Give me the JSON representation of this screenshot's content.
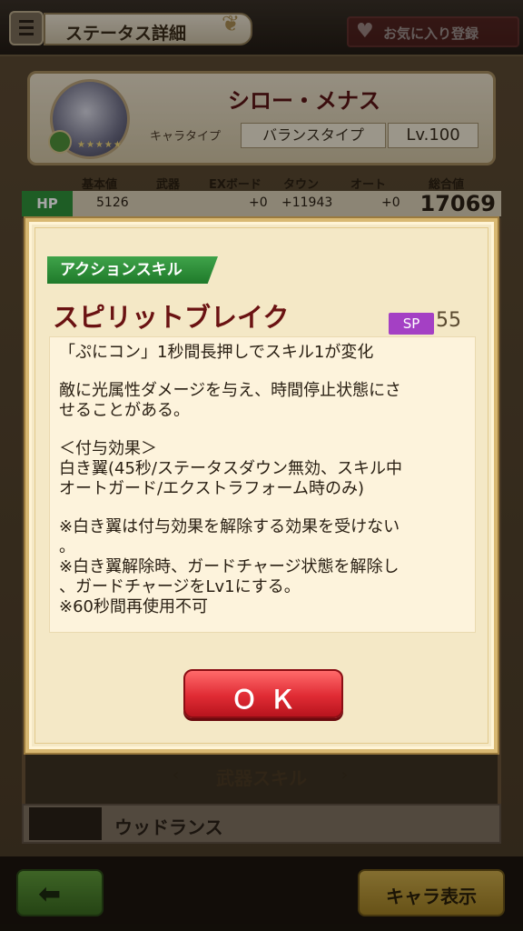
{
  "header": {
    "title": "ステータス詳細",
    "favorite_label": "お気に入り登録"
  },
  "character": {
    "name": "シロー・メナス",
    "type_label": "キャラタイプ",
    "type_value": "バランスタイプ",
    "level": "Lv.100",
    "stars": "★★★★★"
  },
  "stats": {
    "headers": [
      "基本値",
      "武器",
      "EXボード",
      "タウン",
      "オート",
      "総合値"
    ],
    "hp": {
      "label": "HP",
      "base": "5126",
      "ex": "+0",
      "town": "+11943",
      "auto": "+0",
      "total": "17069"
    }
  },
  "modal": {
    "tag": "アクションスキル",
    "skill_name": "スピリットブレイク",
    "sp_label": "SP",
    "sp_value": "55",
    "description": {
      "l1": "「ぷにコン」1秒間長押しでスキル1が変化",
      "l2": "敵に光属性ダメージを与え、時間停止状態にさ",
      "l3": "せることがある。",
      "l4": "＜付与効果＞",
      "l5": "白き翼(45秒/ステータスダウン無効、スキル中",
      "l6": "オートガード/エクストラフォーム時のみ)",
      "l7": "※白き翼は付与効果を解除する効果を受けない",
      "l8": "。",
      "l9": "※白き翼解除時、ガードチャージ状態を解除し",
      "l10": "、ガードチャージをLv1にする。",
      "l11": "※60秒間再使用不可"
    },
    "ok_label": "ＯＫ"
  },
  "weapon": {
    "section_title": "武器スキル",
    "name": "ウッドランス"
  },
  "footer": {
    "chara_label": "キャラ表示"
  }
}
